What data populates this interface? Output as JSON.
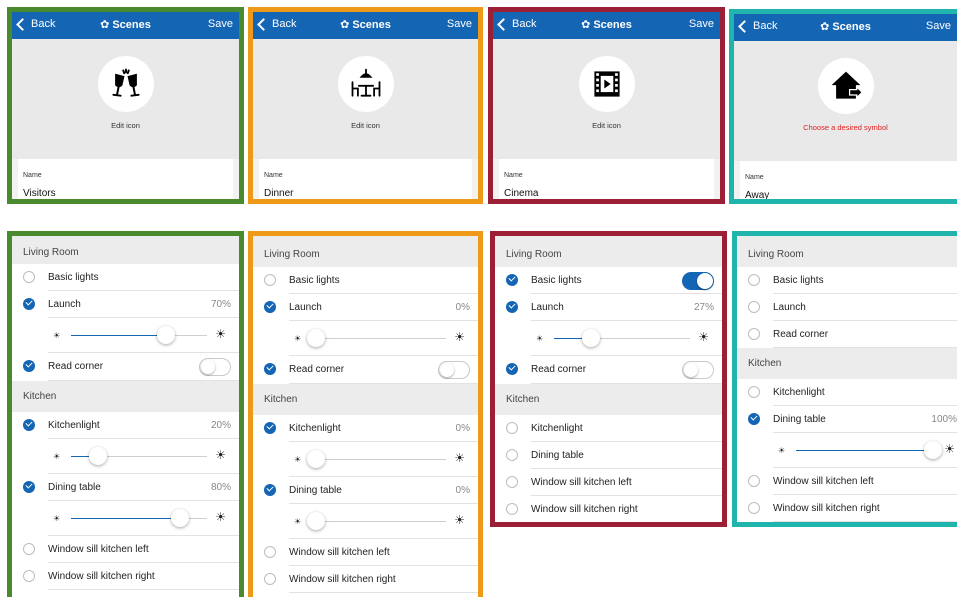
{
  "nav": {
    "back": "Back",
    "title": "Scenes",
    "save": "Save"
  },
  "scenes": [
    {
      "edit_label": "Edit icon",
      "name_label": "Name",
      "name": "Visitors",
      "icon": "wine-glasses-icon"
    },
    {
      "edit_label": "Edit icon",
      "name_label": "Name",
      "name": "Dinner",
      "icon": "dining-table-icon"
    },
    {
      "edit_label": "Edit icon",
      "name_label": "Name",
      "name": "Cinema",
      "icon": "film-icon"
    },
    {
      "edit_label": "Choose a desired symbol",
      "name_label": "Name",
      "name": "Away",
      "icon": "house-exit-icon"
    }
  ],
  "sections": {
    "living_room": "Living Room",
    "kitchen": "Kitchen"
  },
  "devices": {
    "basic_lights": "Basic lights",
    "launch": "Launch",
    "read_corner": "Read corner",
    "kitchenlight": "Kitchenlight",
    "dining_table": "Dining table",
    "sill_left": "Window sill kitchen left",
    "sill_right": "Window sill kitchen right"
  },
  "values": {
    "visitors": {
      "launch": "70%",
      "kitchenlight": "20%",
      "dining": "80%"
    },
    "dinner": {
      "launch": "0%",
      "kitchenlight": "0%",
      "dining": "0%"
    },
    "cinema": {
      "launch": "27%"
    },
    "away": {
      "dining": "100%"
    }
  },
  "colors": {
    "accent": "#1565b5",
    "green": "#4a8a2e",
    "orange": "#ee9a18",
    "red": "#9c2035",
    "teal": "#1fb5ad",
    "alert": "#e02020"
  }
}
